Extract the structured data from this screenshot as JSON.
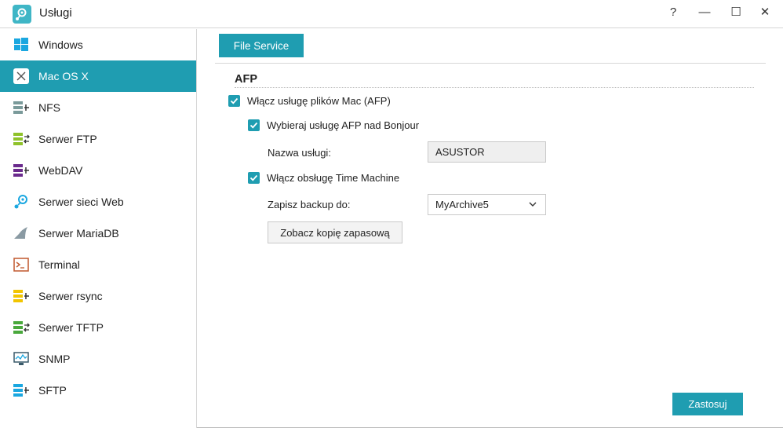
{
  "window": {
    "title": "Usługi",
    "app_icon": "services-icon",
    "controls": [
      {
        "name": "help-button",
        "glyph": "?"
      },
      {
        "name": "minimize-button",
        "glyph": "—"
      },
      {
        "name": "maximize-button",
        "glyph": "☐"
      },
      {
        "name": "close-button",
        "glyph": "✕"
      }
    ]
  },
  "sidebar": {
    "items": [
      {
        "label": "Windows",
        "icon": "windows-icon",
        "active": false
      },
      {
        "label": "Mac OS X",
        "icon": "mac-os-icon",
        "active": true
      },
      {
        "label": "NFS",
        "icon": "nfs-icon",
        "active": false
      },
      {
        "label": "Serwer FTP",
        "icon": "ftp-server-icon",
        "active": false
      },
      {
        "label": "WebDAV",
        "icon": "webdav-icon",
        "active": false
      },
      {
        "label": "Serwer sieci Web",
        "icon": "web-server-icon",
        "active": false
      },
      {
        "label": "Serwer MariaDB",
        "icon": "mariadb-icon",
        "active": false
      },
      {
        "label": "Terminal",
        "icon": "terminal-icon",
        "active": false
      },
      {
        "label": "Serwer rsync",
        "icon": "rsync-server-icon",
        "active": false
      },
      {
        "label": "Serwer TFTP",
        "icon": "tftp-server-icon",
        "active": false
      },
      {
        "label": "SNMP",
        "icon": "snmp-icon",
        "active": false
      },
      {
        "label": "SFTP",
        "icon": "sftp-icon",
        "active": false
      }
    ]
  },
  "main": {
    "tab_label": "File Service",
    "section_title": "AFP",
    "enable_afp": {
      "label": "Włącz usługę plików Mac (AFP)",
      "checked": true
    },
    "bonjour": {
      "label": "Wybieraj usługę AFP nad Bonjour",
      "checked": true
    },
    "service_name": {
      "label": "Nazwa usługi:",
      "value": "ASUSTOR"
    },
    "time_machine": {
      "label": "Włącz obsługę Time Machine",
      "checked": true
    },
    "backup_target": {
      "label": "Zapisz backup do:",
      "value": "MyArchive5"
    },
    "view_backup_button": "Zobacz kopię zapasową",
    "apply_button": "Zastosuj"
  },
  "colors": {
    "accent": "#1f9db1",
    "input_bg": "#efefef",
    "border": "#c9c9c9"
  }
}
